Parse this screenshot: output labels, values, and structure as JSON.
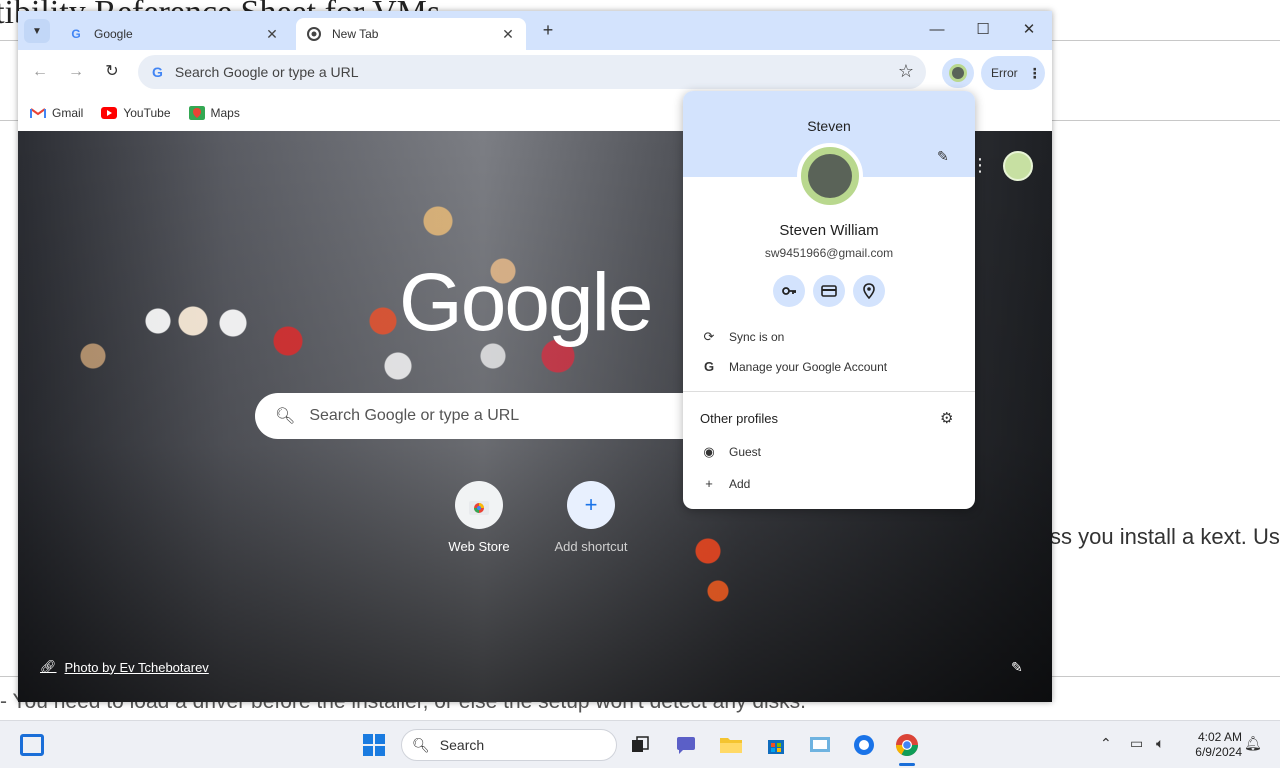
{
  "background_document": {
    "heading": "atibility Reference Sheet for VMs",
    "right_text": "ss you install a kext. Us",
    "bottom_text": "- You need to load a driver before the installer, or else the setup won't detect any disks."
  },
  "browser": {
    "tabs": [
      {
        "label": "Google",
        "favicon": "google-g-icon",
        "active": false
      },
      {
        "label": "New Tab",
        "favicon": "chrome-icon",
        "active": true
      }
    ],
    "omnibox": {
      "placeholder": "Search Google or type a URL"
    },
    "error_button": "Error",
    "bookmarks": [
      {
        "label": "Gmail",
        "icon": "gmail-icon",
        "color": "#ea4335"
      },
      {
        "label": "YouTube",
        "icon": "youtube-icon",
        "color": "#ff0000"
      },
      {
        "label": "Maps",
        "icon": "maps-icon",
        "color": "#34a853"
      }
    ],
    "new_tab_page": {
      "logo_text": "Google",
      "search_placeholder": "Search Google or type a URL",
      "shortcuts": [
        {
          "label": "Web Store",
          "icon": "web-store-icon"
        },
        {
          "label": "Add shortcut",
          "icon": "plus-icon"
        }
      ],
      "photo_credit": "Photo by Ev Tchebotarev"
    }
  },
  "profile_menu": {
    "header_name": "Steven",
    "full_name": "Steven William",
    "email": "sw9451966@gmail.com",
    "quick_icons": [
      "password-key-icon",
      "payment-card-icon",
      "location-pin-icon"
    ],
    "sync_label": "Sync is on",
    "manage_label": "Manage your Google Account",
    "other_profiles_label": "Other profiles",
    "guest_label": "Guest",
    "add_label": "Add"
  },
  "taskbar": {
    "search_label": "Search",
    "time": "4:02 AM",
    "date": "6/9/2024",
    "accent": "#1a6ed8"
  }
}
